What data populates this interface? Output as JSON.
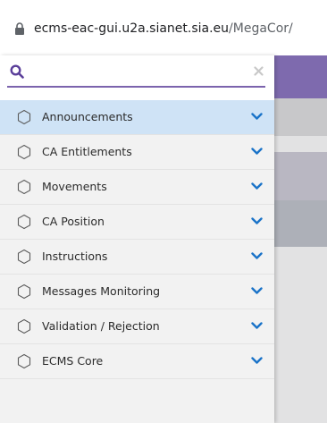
{
  "browser": {
    "url_host": "ecms-eac-gui.u2a.sianet.sia.eu",
    "url_path": "/MegaCor/"
  },
  "search": {
    "value": "",
    "placeholder": ""
  },
  "colors": {
    "accent": "#7b63ad",
    "header_purple": "#7e6aae",
    "active_item": "#cfe3f6",
    "chevron": "#1a73c8"
  },
  "menu": {
    "items": [
      {
        "label": "Announcements",
        "icon": "hexagon-icon"
      },
      {
        "label": "CA Entitlements",
        "icon": "hexagon-icon"
      },
      {
        "label": "Movements",
        "icon": "hexagon-icon"
      },
      {
        "label": "CA Position",
        "icon": "hexagon-icon"
      },
      {
        "label": "Instructions",
        "icon": "hexagon-icon"
      },
      {
        "label": "Messages Monitoring",
        "icon": "hexagon-icon"
      },
      {
        "label": "Validation / Rejection",
        "icon": "hexagon-icon"
      },
      {
        "label": "ECMS Core",
        "icon": "hexagon-icon"
      }
    ]
  }
}
